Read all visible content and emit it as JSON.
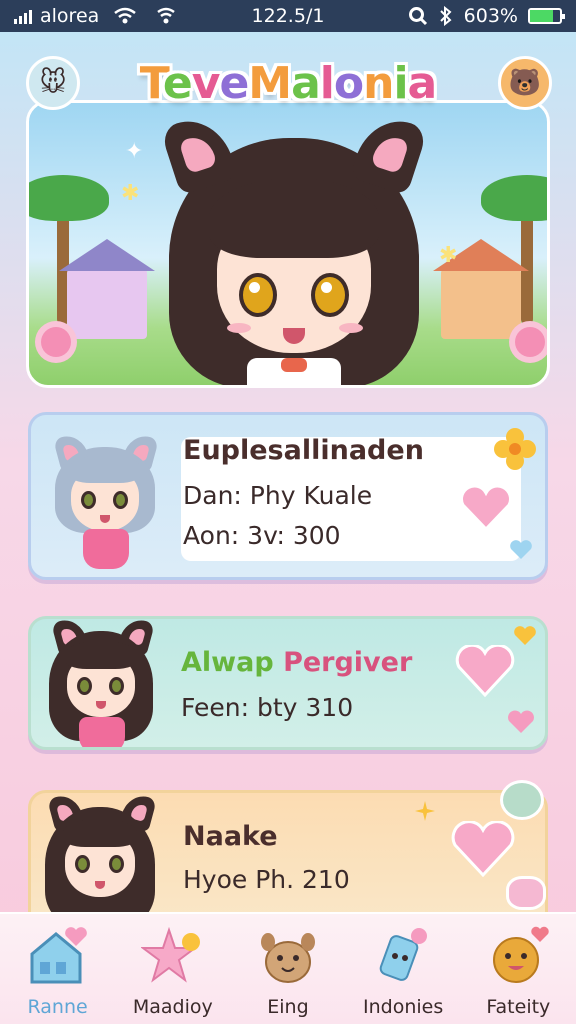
{
  "status_bar": {
    "carrier": "alorea",
    "time": "122.5/1",
    "battery_percent": "603%",
    "battery_level": 0.75
  },
  "game": {
    "title": "TeveMalonia"
  },
  "cards": [
    {
      "name": "Euplesallinaden",
      "line1": "Dan: Phy Kuale",
      "line2": "Aon: 3v: 300"
    },
    {
      "name_part1": "Alwap",
      "name_part2": "Pergiver",
      "line1": "Feen: bty 310"
    },
    {
      "name": "Naake",
      "line1": "Hyoe Ph. 210"
    }
  ],
  "bottom_nav": {
    "items": [
      {
        "label": "Ranne",
        "icon": "house-heart-icon",
        "active": true
      },
      {
        "label": "Maadioy",
        "icon": "star-heart-icon",
        "active": false
      },
      {
        "label": "Eing",
        "icon": "pet-dog-icon",
        "active": false
      },
      {
        "label": "Indonies",
        "icon": "pencil-heart-icon",
        "active": false
      },
      {
        "label": "Fateity",
        "icon": "smiley-ball-icon",
        "active": false
      }
    ]
  },
  "colors": {
    "accent_blue": "#5fa6d6",
    "heart_pink": "#f59bbf",
    "status_bar": "#2c3e5a"
  }
}
